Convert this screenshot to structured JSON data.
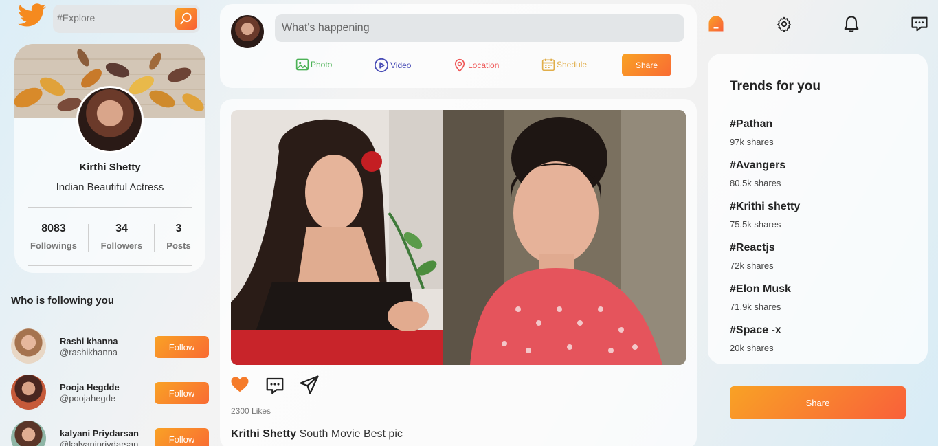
{
  "search": {
    "placeholder": "#Explore"
  },
  "profile": {
    "name": "Kirthi Shetty",
    "description": "Indian Beautiful Actress",
    "stats": [
      {
        "value": "8083",
        "label": "Followings"
      },
      {
        "value": "34",
        "label": "Followers"
      },
      {
        "value": "3",
        "label": "Posts"
      }
    ]
  },
  "followers_section": {
    "title": "Who is following you",
    "items": [
      {
        "name": "Rashi khanna",
        "handle": "@rashikhanna",
        "button": "Follow"
      },
      {
        "name": "Pooja Hegdde",
        "handle": "@poojahegde",
        "button": "Follow"
      },
      {
        "name": "kalyani Priydarsan",
        "handle": "@kalyanipriydarsan",
        "button": "Follow"
      }
    ]
  },
  "composer": {
    "placeholder": "What's happening",
    "options": [
      {
        "label": "Photo",
        "icon": "photo-icon",
        "color": "#4cb256"
      },
      {
        "label": "Video",
        "icon": "video-icon",
        "color": "#4a4eb7"
      },
      {
        "label": "Location",
        "icon": "location-icon",
        "color": "#ef5757"
      },
      {
        "label": "Shedule",
        "icon": "calendar-icon",
        "color": "#e1ae4a"
      }
    ],
    "share_label": "Share"
  },
  "post": {
    "likes": "2300 Likes",
    "author": "Krithi Shetty",
    "caption": "South Movie Best pic"
  },
  "trends": {
    "title": "Trends for you",
    "items": [
      {
        "tag": "#Pathan",
        "shares": "97k shares"
      },
      {
        "tag": "#Avangers",
        "shares": "80.5k shares"
      },
      {
        "tag": "#Krithi shetty",
        "shares": "75.5k shares"
      },
      {
        "tag": "#Reactjs",
        "shares": "72k shares"
      },
      {
        "tag": "#Elon Musk",
        "shares": "71.9k shares"
      },
      {
        "tag": "#Space -x",
        "shares": "20k shares"
      }
    ]
  },
  "share_button": "Share",
  "colors": {
    "accent_start": "#f9a225",
    "accent_end": "#f96b33",
    "heart": "#f57b2a"
  }
}
